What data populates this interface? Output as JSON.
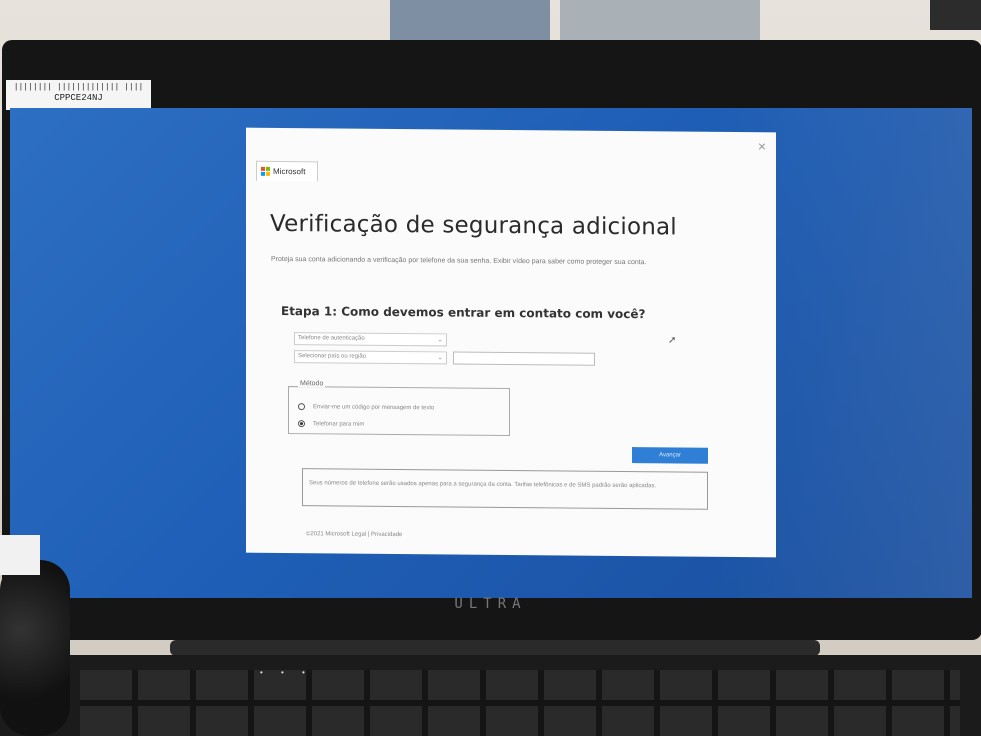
{
  "sticker": {
    "code": "CPPCE24NJ"
  },
  "dialog": {
    "brand": "Microsoft",
    "close_glyph": "×",
    "title": "Verificação de segurança adicional",
    "description": "Proteja sua conta adicionando a verificação por telefone da sua senha. Exibir vídeo para saber como proteger sua conta.",
    "step_heading": "Etapa 1: Como devemos entrar em contato com você?",
    "device_select": "Telefone de autenticação",
    "country_select": "Selecionar país ou região",
    "phone_value": "",
    "method_legend": "Método",
    "method_options": [
      {
        "label": "Enviar-me um código por mensagem de texto",
        "checked": false
      },
      {
        "label": "Telefonar para mim",
        "checked": true
      }
    ],
    "next_label": "Avançar",
    "notice": "Seus números de telefone serão usados apenas para a segurança da conta. Tarifas telefônicas e de SMS padrão serão aplicadas.",
    "footer": "©2021 Microsoft   Legal  |  Privacidade"
  },
  "laptop": {
    "brand": "ULTRA"
  },
  "colors": {
    "desktop": "#1f5fb7",
    "accent": "#2f7fd6"
  }
}
